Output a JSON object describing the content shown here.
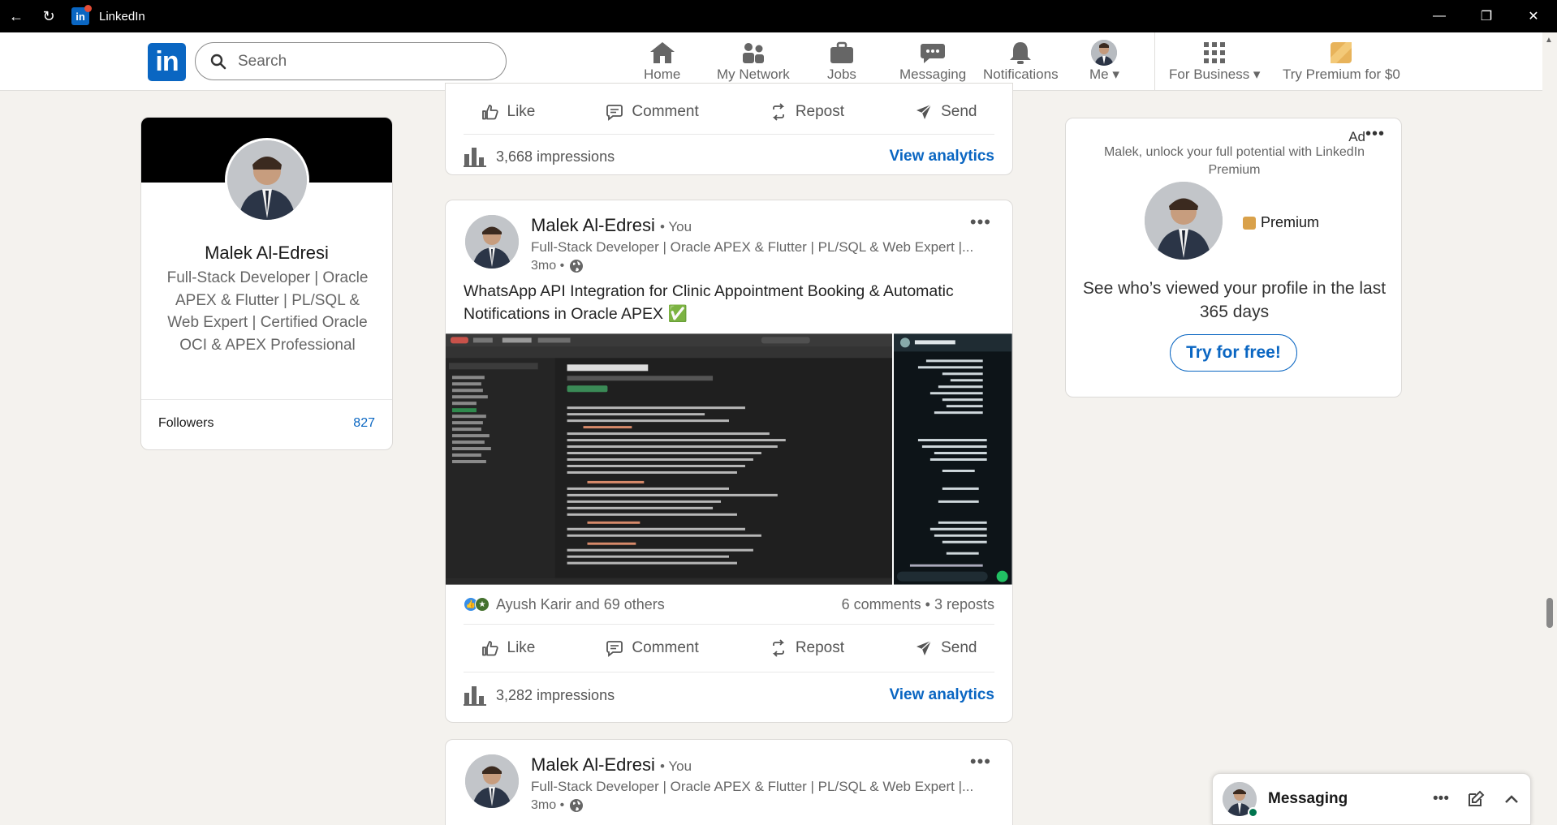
{
  "window": {
    "title": "LinkedIn"
  },
  "nav": {
    "search_placeholder": "Search",
    "items": [
      {
        "label": "Home"
      },
      {
        "label": "My Network"
      },
      {
        "label": "Jobs"
      },
      {
        "label": "Messaging"
      },
      {
        "label": "Notifications"
      },
      {
        "label": "Me"
      },
      {
        "label": "For Business"
      },
      {
        "label": "Try Premium for $0"
      }
    ]
  },
  "profile": {
    "name": "Malek Al-Edresi",
    "headline": "Full-Stack Developer | Oracle APEX & Flutter | PL/SQL & Web Expert | Certified Oracle OCI & APEX Professional",
    "stat_label": "Followers",
    "stat_value": "827"
  },
  "actions": {
    "like": "Like",
    "comment": "Comment",
    "repost": "Repost",
    "send": "Send"
  },
  "posts": [
    {
      "impressions": "3,668 impressions",
      "view_analytics": "View analytics"
    },
    {
      "author": "Malek Al-Edresi",
      "you": "• You",
      "subtitle": "Full-Stack Developer | Oracle APEX & Flutter | PL/SQL & Web Expert |...",
      "time": "3mo •",
      "text": "WhatsApp API Integration for Clinic Appointment Booking & Automatic Notifications in Oracle APEX ✅",
      "reactions": "Ayush Karir and 69 others",
      "engagement": "6 comments • 3 reposts",
      "impressions": "3,282 impressions",
      "view_analytics": "View analytics"
    },
    {
      "author": "Malek Al-Edresi",
      "you": "• You",
      "subtitle": "Full-Stack Developer | Oracle APEX & Flutter | PL/SQL & Web Expert |...",
      "time": "3mo •"
    }
  ],
  "ad": {
    "label": "Ad",
    "headline": "Malek, unlock your full potential with LinkedIn Premium",
    "premium_label": "Premium",
    "body": "See who’s viewed your profile in the last 365 days",
    "button": "Try for free!"
  },
  "messaging": {
    "label": "Messaging"
  },
  "colors": {
    "brand": "#0a66c2",
    "background": "#f4f2ee",
    "online": "#01754f"
  }
}
